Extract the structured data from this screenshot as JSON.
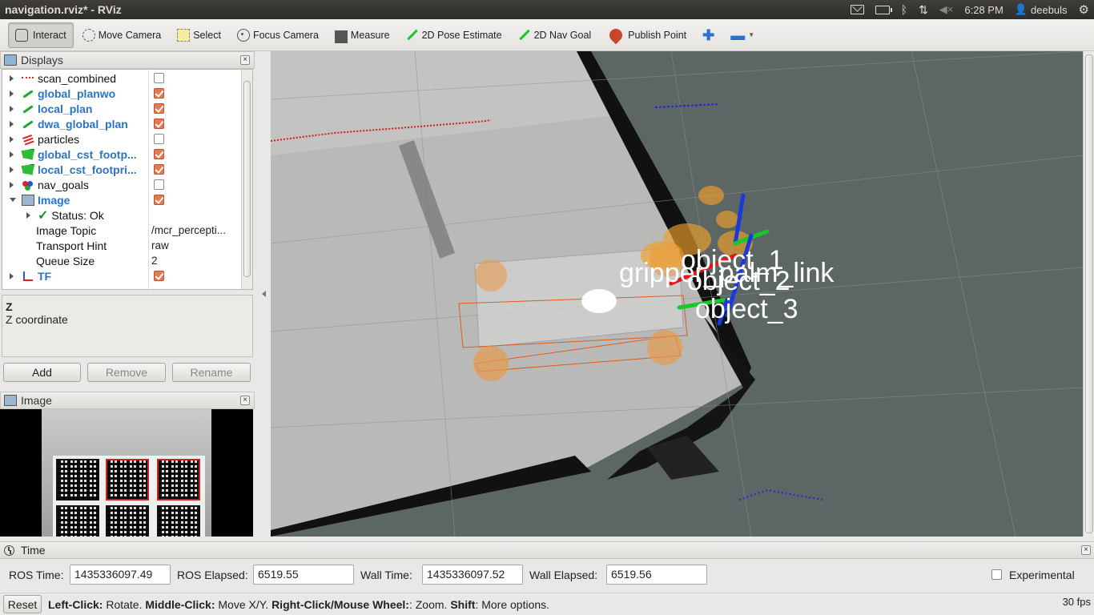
{
  "window": {
    "title": "navigation.rviz* - RViz",
    "tray": {
      "time": "6:28 PM",
      "user": "deebuls"
    }
  },
  "toolbar": {
    "tools": [
      {
        "label": "Interact",
        "icon": "hand-icon",
        "active": true
      },
      {
        "label": "Move Camera",
        "icon": "move-camera-icon"
      },
      {
        "label": "Select",
        "icon": "select-icon"
      },
      {
        "label": "Focus Camera",
        "icon": "focus-camera-icon"
      },
      {
        "label": "Measure",
        "icon": "measure-icon"
      },
      {
        "label": "2D Pose Estimate",
        "icon": "green-arrow-icon"
      },
      {
        "label": "2D Nav Goal",
        "icon": "green-arrow-icon"
      },
      {
        "label": "Publish Point",
        "icon": "map-pin-icon"
      }
    ],
    "add_symbol": "✚",
    "remove_symbol": "▬"
  },
  "displays": {
    "header": "Displays",
    "rows": [
      {
        "name": "scan_combined",
        "checked": false,
        "icon": "laser-scan-icon",
        "bold": false
      },
      {
        "name": "global_planwo",
        "checked": true,
        "icon": "path-icon",
        "bold": true
      },
      {
        "name": "local_plan",
        "checked": true,
        "icon": "path-icon",
        "bold": true
      },
      {
        "name": "dwa_global_plan",
        "checked": true,
        "icon": "path-icon",
        "bold": true
      },
      {
        "name": "particles",
        "checked": false,
        "icon": "pose-array-icon",
        "bold": false
      },
      {
        "name": "global_cst_footp...",
        "checked": true,
        "icon": "polygon-icon",
        "bold": true
      },
      {
        "name": "local_cst_footpri...",
        "checked": true,
        "icon": "polygon-icon",
        "bold": true
      },
      {
        "name": "nav_goals",
        "checked": false,
        "icon": "markers-icon",
        "bold": false
      },
      {
        "name": "Image",
        "checked": true,
        "icon": "image-icon",
        "bold": true
      }
    ],
    "image_children": {
      "status": "Status: Ok",
      "props": [
        {
          "label": "Image Topic",
          "value": "/mcr_percepti..."
        },
        {
          "label": "Transport Hint",
          "value": "raw"
        },
        {
          "label": "Queue Size",
          "value": "2"
        }
      ]
    },
    "tf_row": {
      "name": "TF",
      "checked": true
    }
  },
  "description": {
    "title": "Z",
    "text": "Z coordinate"
  },
  "buttons": {
    "add": "Add",
    "remove": "Remove",
    "rename": "Rename"
  },
  "image_panel": {
    "header": "Image"
  },
  "viewport": {
    "labels": [
      "object_1",
      "gripper_palm_link",
      "object_2",
      "object_3"
    ]
  },
  "time_panel": {
    "header": "Time",
    "ros_time_label": "ROS Time:",
    "ros_time": "1435336097.49",
    "ros_elapsed_label": "ROS Elapsed:",
    "ros_elapsed": "6519.55",
    "wall_time_label": "Wall Time:",
    "wall_time": "1435336097.52",
    "wall_elapsed_label": "Wall Elapsed:",
    "wall_elapsed": "6519.56",
    "experimental_label": "Experimental"
  },
  "status": {
    "reset": "Reset",
    "hint_parts": [
      "Left-Click:",
      " Rotate. ",
      "Middle-Click:",
      " Move X/Y. ",
      "Right-Click/Mouse Wheel:",
      ": Zoom. ",
      "Shift",
      ": More options."
    ],
    "fps": "30 fps"
  }
}
